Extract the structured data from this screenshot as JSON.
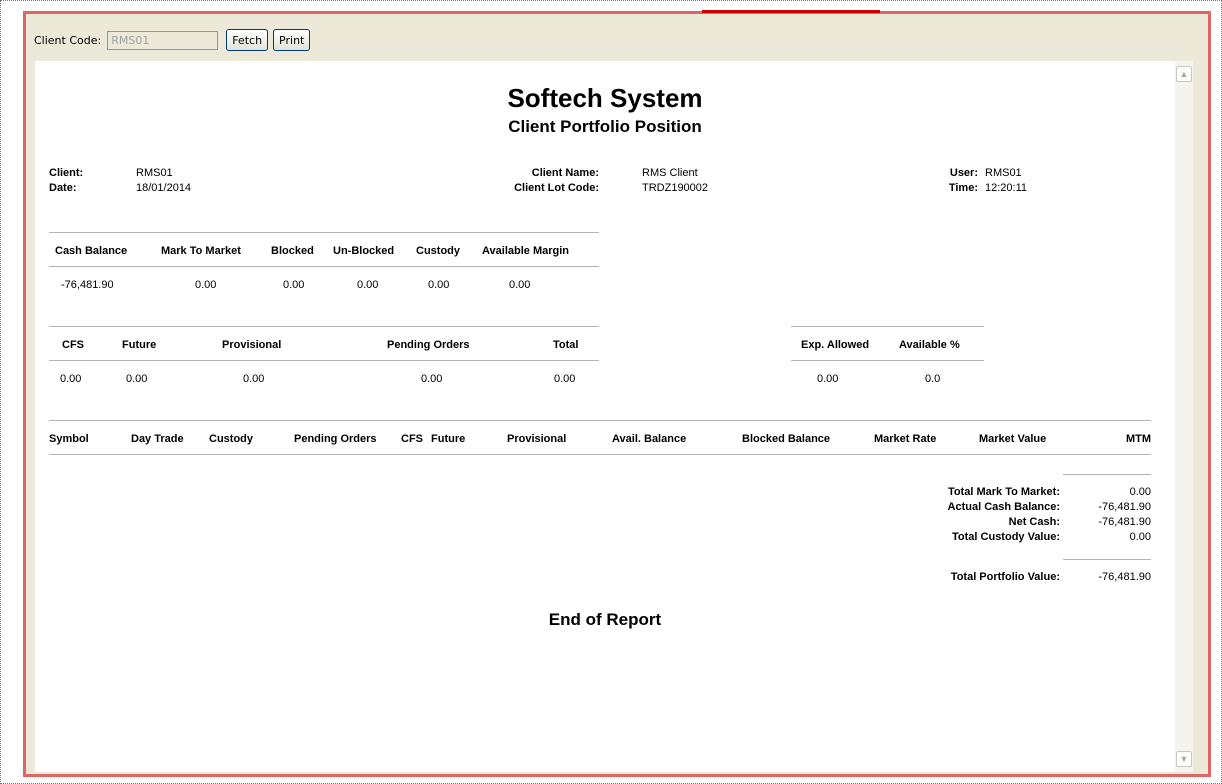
{
  "toolbar": {
    "client_code_label": "Client Code:",
    "client_code_value": "RMS01",
    "fetch_label": "Fetch",
    "print_label": "Print"
  },
  "report": {
    "company": "Softech System",
    "subtitle": "Client Portfolio Position",
    "info": {
      "client_label": "Client:",
      "client_value": "RMS01",
      "date_label": "Date:",
      "date_value": "18/01/2014",
      "client_name_label": "Client Name:",
      "client_name_value": "RMS Client",
      "lot_code_label": "Client Lot Code:",
      "lot_code_value": "TRDZ190002",
      "user_label": "User:",
      "user_value": "RMS01",
      "time_label": "Time:",
      "time_value": "12:20:11"
    },
    "margin_table": {
      "headers": [
        "Cash Balance",
        "Mark To Market",
        "Blocked",
        "Un-Blocked",
        "Custody",
        "Available Margin"
      ],
      "values": [
        "-76,481.90",
        "0.00",
        "0.00",
        "0.00",
        "0.00",
        "0.00"
      ]
    },
    "exposure_table": {
      "headers": [
        "CFS",
        "Future",
        "Provisional",
        "Pending Orders",
        "Total"
      ],
      "values": [
        "0.00",
        "0.00",
        "0.00",
        "0.00",
        "0.00"
      ]
    },
    "allowed_table": {
      "headers": [
        "Exp. Allowed",
        "Available %"
      ],
      "values": [
        "0.00",
        "0.0"
      ]
    },
    "holdings_headers": [
      "Symbol",
      "Day Trade",
      "Custody",
      "Pending Orders",
      "CFS",
      "Future",
      "Provisional",
      "Avail. Balance",
      "Blocked Balance",
      "Market Rate",
      "Market Value",
      "MTM"
    ],
    "totals": [
      {
        "label": "Total Mark To Market:",
        "value": "0.00"
      },
      {
        "label": "Actual Cash Balance:",
        "value": "-76,481.90"
      },
      {
        "label": "Net Cash:",
        "value": "-76,481.90"
      },
      {
        "label": "Total Custody Value:",
        "value": "0.00"
      }
    ],
    "portfolio_total": {
      "label": "Total Portfolio Value:",
      "value": "-76,481.90"
    },
    "end_text": "End of Report"
  },
  "icons": {
    "scroll_up": "chevron-up-icon",
    "scroll_down": "chevron-down-icon"
  }
}
